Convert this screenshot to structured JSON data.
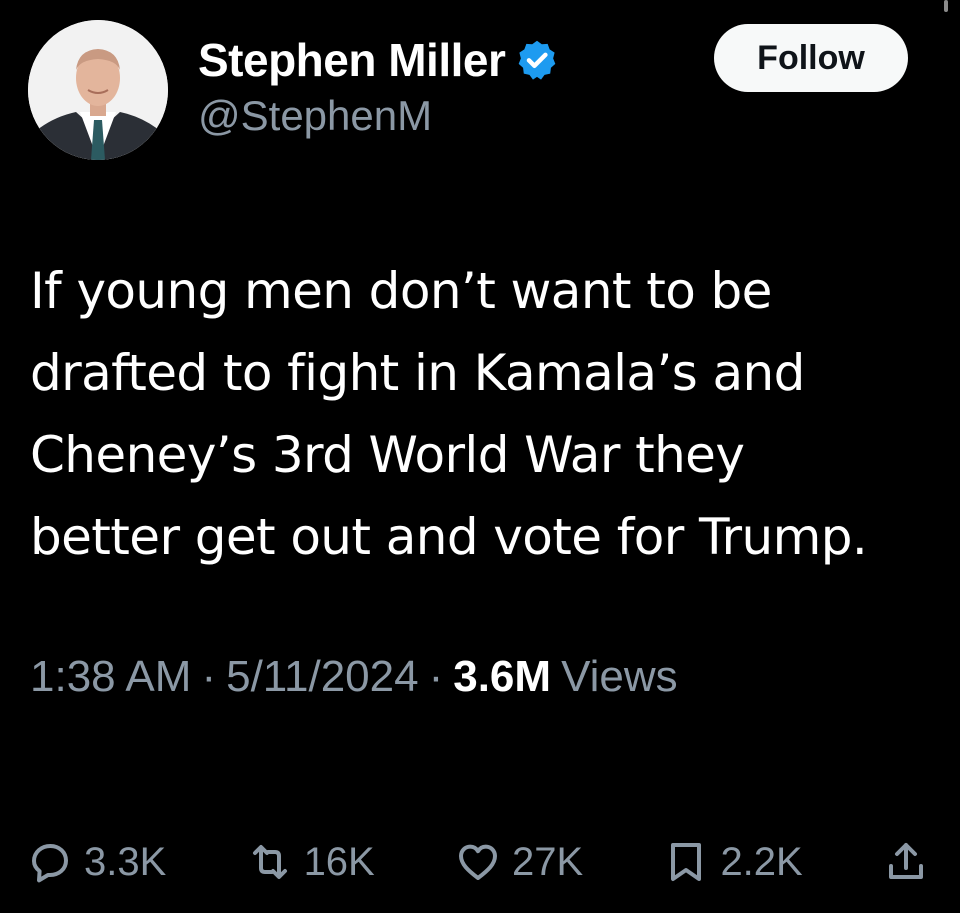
{
  "author": {
    "display_name": "Stephen Miller",
    "handle": "@StephenM",
    "verified": true,
    "avatar_icon": "profile-photo"
  },
  "follow_label": "Follow",
  "tweet": {
    "text": "If young men don’t want to be\ndrafted to fight in Kamala’s and\nCheney’s 3rd World War they\nbetter get out and vote for Trump."
  },
  "meta": {
    "time": "1:38 AM",
    "separator": "·",
    "date": "5/11/2024",
    "views_count": "3.6M",
    "views_label": "Views"
  },
  "actions": {
    "replies": "3.3K",
    "reposts": "16K",
    "likes": "27K",
    "bookmarks": "2.2K"
  },
  "icons": {
    "reply": "reply-icon",
    "repost": "repost-icon",
    "like": "heart-icon",
    "bookmark": "bookmark-icon",
    "share": "share-icon",
    "verified": "verified-badge-icon"
  },
  "colors": {
    "background": "#000000",
    "text_primary": "#ffffff",
    "text_secondary": "#8b98a5",
    "verified_blue": "#1d9bf0",
    "follow_bg": "#f7f9f9"
  }
}
